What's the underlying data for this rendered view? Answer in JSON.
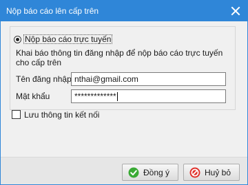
{
  "window": {
    "title": "Nộp báo cáo lên cấp trên",
    "close_icon": "close-icon",
    "title_bar_color": "#2f86d8"
  },
  "form": {
    "mode_option": {
      "label": "Nộp báo cáo trực tuyến",
      "selected": true
    },
    "description": "Khai báo thông tin đăng nhập để nộp báo cáo trực tuyến\ncho cấp trên",
    "username": {
      "label": "Tên đăng nhập",
      "value": "nthai@gmail.com"
    },
    "password": {
      "label": "Mật khẩu",
      "masked_value": "*************"
    },
    "save_connection": {
      "label": "Lưu thông tin kết nối",
      "checked": false
    }
  },
  "buttons": {
    "ok": {
      "label": "Đồng ý",
      "icon": "green-checkmark-icon",
      "color": "#3aaa35"
    },
    "cancel": {
      "label": "Huỷ bỏ",
      "icon": "red-no-entry-icon",
      "color": "#e0302a"
    }
  }
}
